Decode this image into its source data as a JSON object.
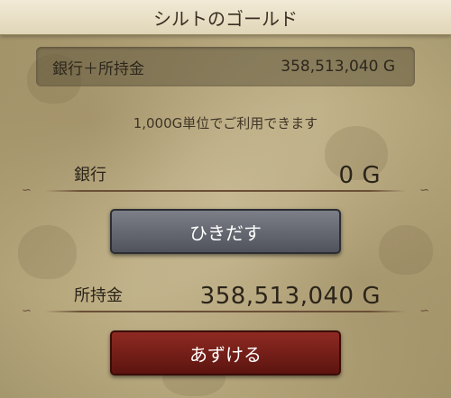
{
  "header": {
    "title": "シルトのゴールド"
  },
  "summary": {
    "label": "銀行＋所持金",
    "value": "358,513,040 G"
  },
  "note": "1,000G単位でご利用できます",
  "bank": {
    "label": "銀行",
    "value": "0 G"
  },
  "withdraw_button": "ひきだす",
  "on_hand": {
    "label": "所持金",
    "value": "358,513,040 G"
  },
  "deposit_button": "あずける",
  "colors": {
    "withdraw": "#5e6168",
    "deposit": "#7a1f18",
    "background": "#c8bb93"
  }
}
